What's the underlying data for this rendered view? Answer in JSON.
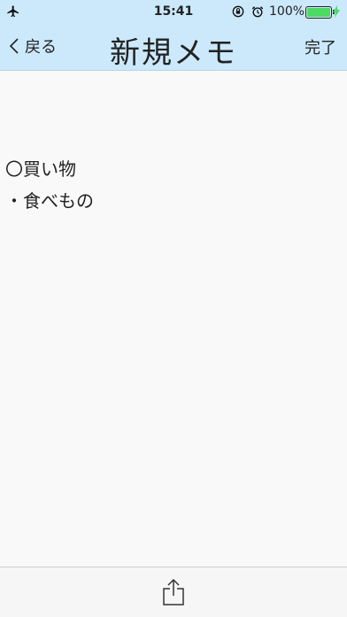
{
  "status_bar": {
    "time": "15:41",
    "battery_percent": "100%",
    "battery_level": 1.0,
    "icons": [
      "airplane-icon",
      "rotation-lock-icon",
      "alarm-icon",
      "battery-icon",
      "charging-bolt-icon"
    ]
  },
  "nav": {
    "back_label": "戻る",
    "title": "新規メモ",
    "done_label": "完了"
  },
  "note": {
    "lines": [
      "〇買い物",
      "・食べもの"
    ]
  },
  "toolbar": {
    "share_icon": "share-icon"
  },
  "colors": {
    "header_bg": "#cbe9fb",
    "battery_green": "#4cd964"
  }
}
